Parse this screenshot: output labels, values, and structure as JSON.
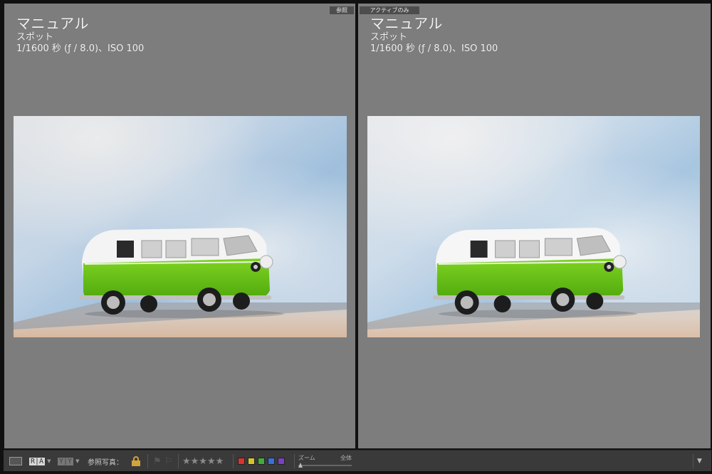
{
  "left_pane": {
    "tag": "参照",
    "mode": "マニュアル",
    "metering": "スポット",
    "exposure": "1/1600 秒 (ƒ / 8.0)、ISO 100"
  },
  "right_pane": {
    "tag": "アクティブのみ",
    "mode": "マニュアル",
    "metering": "スポット",
    "exposure": "1/1600 秒 (ƒ / 8.0)、ISO 100"
  },
  "toolbar": {
    "ra_label": "R|A",
    "yy_label": "Y|Y",
    "reference_label": "参照写真：",
    "stars": "★★★★★",
    "zoom_label": "ズーム",
    "zoom_value": "全体",
    "zoom_level": 0,
    "color_labels": [
      {
        "name": "red",
        "color": "#d9342b"
      },
      {
        "name": "yellow",
        "color": "#d4c62a"
      },
      {
        "name": "green",
        "color": "#3fae3a"
      },
      {
        "name": "blue",
        "color": "#3a6fd8"
      },
      {
        "name": "purple",
        "color": "#7b3fc4"
      }
    ]
  }
}
